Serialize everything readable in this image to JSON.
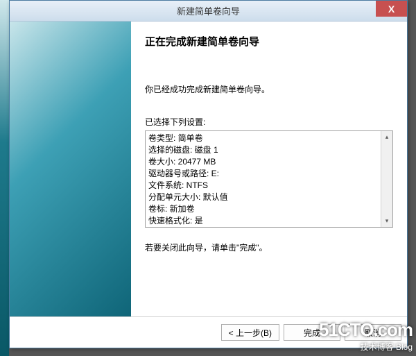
{
  "title_bar": {
    "title": "新建简单卷向导",
    "close_symbol": "X"
  },
  "wizard": {
    "heading": "正在完成新建简单卷向导",
    "intro": "你已经成功完成新建简单卷向导。",
    "settings_label": "已选择下列设置:",
    "settings": [
      "卷类型: 简单卷",
      "选择的磁盘: 磁盘 1",
      "卷大小: 20477 MB",
      "驱动器号或路径: E:",
      "文件系统: NTFS",
      "分配单元大小: 默认值",
      "卷标: 新加卷",
      "快速格式化: 是"
    ],
    "finish_text": "若要关闭此向导，请单击\"完成\"。"
  },
  "buttons": {
    "back": "< 上一步(B)",
    "finish": "完成",
    "cancel": "取消"
  },
  "scroll": {
    "up": "▴",
    "down": "▾"
  },
  "watermark": {
    "line1": "51CTO.com",
    "line2": "技术博客 Blog"
  }
}
